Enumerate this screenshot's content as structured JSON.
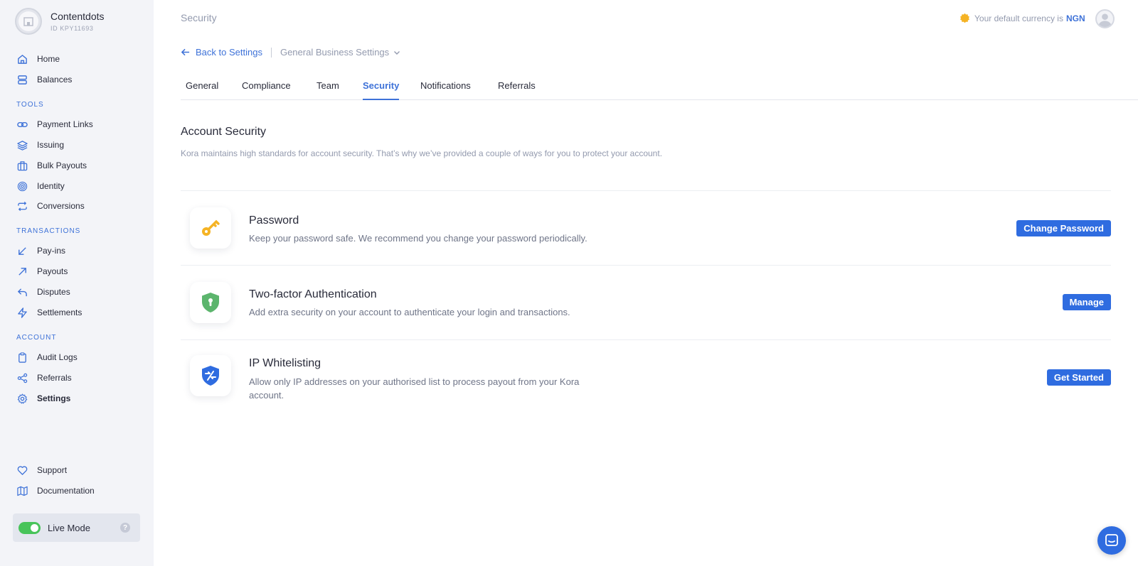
{
  "brand": {
    "name": "Contentdots",
    "id": "ID KPY11693"
  },
  "sidebar": {
    "main": [
      {
        "label": "Home",
        "icon": "home-icon"
      },
      {
        "label": "Balances",
        "icon": "database-icon"
      }
    ],
    "tools_title": "TOOLS",
    "tools": [
      {
        "label": "Payment Links",
        "icon": "link-icon"
      },
      {
        "label": "Issuing",
        "icon": "layers-icon"
      },
      {
        "label": "Bulk Payouts",
        "icon": "briefcase-icon"
      },
      {
        "label": "Identity",
        "icon": "fingerprint-icon"
      },
      {
        "label": "Conversions",
        "icon": "repeat-icon"
      }
    ],
    "transactions_title": "TRANSACTIONS",
    "transactions": [
      {
        "label": "Pay-ins",
        "icon": "arrow-down-left-icon"
      },
      {
        "label": "Payouts",
        "icon": "arrow-up-right-icon"
      },
      {
        "label": "Disputes",
        "icon": "corner-up-left-icon"
      },
      {
        "label": "Settlements",
        "icon": "zap-icon"
      }
    ],
    "account_title": "ACCOUNT",
    "account": [
      {
        "label": "Audit Logs",
        "icon": "clipboard-icon"
      },
      {
        "label": "Referrals",
        "icon": "share-icon"
      },
      {
        "label": "Settings",
        "icon": "gear-icon",
        "active": true
      }
    ],
    "bottom": [
      {
        "label": "Support",
        "icon": "heart-icon"
      },
      {
        "label": "Documentation",
        "icon": "map-icon"
      }
    ],
    "live_mode": {
      "label": "Live Mode",
      "enabled": true
    }
  },
  "header": {
    "title": "Security",
    "currency_text": "Your default currency is",
    "currency_code": "NGN"
  },
  "nav": {
    "back_label": "Back to Settings",
    "dropdown_label": "General Business Settings"
  },
  "tabs": [
    {
      "label": "General"
    },
    {
      "label": "Compliance"
    },
    {
      "label": "Team"
    },
    {
      "label": "Security",
      "active": true
    },
    {
      "label": "Notifications"
    },
    {
      "label": "Referrals"
    }
  ],
  "section": {
    "title": "Account Security",
    "description": "Kora maintains high standards for account security. That’s why we’ve provided a couple of ways for you to protect your account."
  },
  "security_items": [
    {
      "title": "Password",
      "description": "Keep your password safe. We recommend you change your password periodically.",
      "button": "Change Password",
      "icon": "key-icon"
    },
    {
      "title": "Two-factor Authentication",
      "description": "Add extra security on your account to authenticate your login and transactions.",
      "button": "Manage",
      "icon": "shield-lock-icon"
    },
    {
      "title": "IP Whitelisting",
      "description_line1": "Allow only IP addresses on your authorised list to process payout from your Kora",
      "description_line2": "account.",
      "button": "Get Started",
      "icon": "shield-ip-icon"
    }
  ],
  "colors": {
    "accent": "#2f6ce0",
    "sidebar_bg": "#f3f4f8",
    "toggle_on": "#48c45a",
    "key": "#f5b324",
    "shield_green": "#5cb56d"
  }
}
